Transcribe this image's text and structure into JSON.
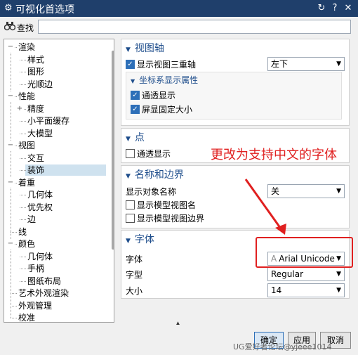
{
  "window": {
    "title": "可视化首选项",
    "controls": [
      "↻",
      "?",
      "✕"
    ]
  },
  "search": {
    "label": "查找",
    "placeholder": "",
    "value": ""
  },
  "tree": [
    {
      "label": "渲染",
      "level": 0,
      "exp": "−"
    },
    {
      "label": "样式",
      "level": 1
    },
    {
      "label": "图形",
      "level": 1
    },
    {
      "label": "光顺边",
      "level": 1
    },
    {
      "label": "性能",
      "level": 0,
      "exp": "−"
    },
    {
      "label": "精度",
      "level": 1,
      "exp": "+"
    },
    {
      "label": "小平面缓存",
      "level": 1
    },
    {
      "label": "大模型",
      "level": 1
    },
    {
      "label": "视图",
      "level": 0,
      "exp": "−"
    },
    {
      "label": "交互",
      "level": 1
    },
    {
      "label": "装饰",
      "level": 1,
      "selected": true
    },
    {
      "label": "着重",
      "level": 0,
      "exp": "−"
    },
    {
      "label": "几何体",
      "level": 1
    },
    {
      "label": "优先权",
      "level": 1
    },
    {
      "label": "边",
      "level": 1
    },
    {
      "label": "线",
      "level": 0
    },
    {
      "label": "颜色",
      "level": 0,
      "exp": "−"
    },
    {
      "label": "几何体",
      "level": 1
    },
    {
      "label": "手柄",
      "level": 1
    },
    {
      "label": "图纸布局",
      "level": 1
    },
    {
      "label": "艺术外观渲染",
      "level": 0
    },
    {
      "label": "外观管理",
      "level": 0
    },
    {
      "label": "校准",
      "level": 0
    }
  ],
  "view_triad": {
    "title": "视图轴",
    "show_triad_label": "显示视图三重轴",
    "position_value": "左下",
    "sub_title": "坐标系显示属性",
    "see_through_label": "通透显示",
    "fixed_size_label": "屏显固定大小"
  },
  "point": {
    "title": "点",
    "see_through_label": "通透显示"
  },
  "names_borders": {
    "title": "名称和边界",
    "show_object_name_label": "显示对象名称",
    "show_object_name_value": "关",
    "show_model_view_name_label": "显示模型视图名",
    "show_model_view_border_label": "显示模型视图边界"
  },
  "font": {
    "title": "字体",
    "font_label": "字体",
    "font_value": "Arial Unicode",
    "style_label": "字型",
    "style_value": "Regular",
    "size_label": "大小",
    "size_value": "14"
  },
  "annotation": {
    "text": "更改为支持中文的字体",
    "color": "#e02020"
  },
  "buttons": {
    "ok": "确定",
    "apply": "应用",
    "cancel": "取消"
  },
  "watermark": "UG爱好者论坛@yjeee1014",
  "colors": {
    "titlebar": "#1f3f6b",
    "section_header": "#1f4e8c",
    "checkbox_on": "#2d6fb8",
    "annotation": "#e02020"
  }
}
